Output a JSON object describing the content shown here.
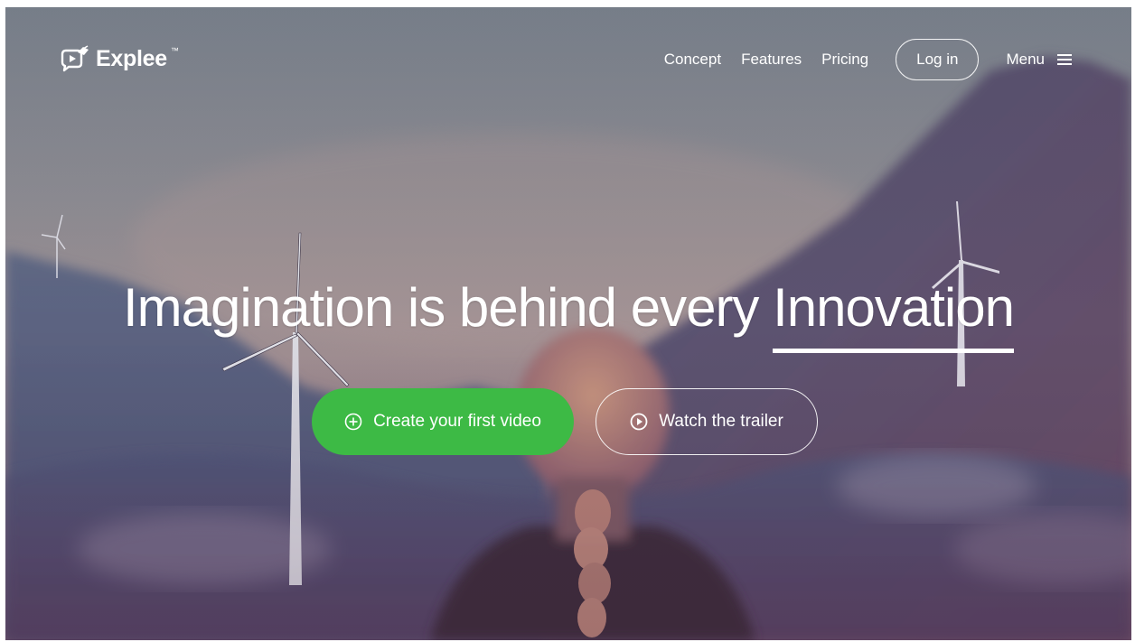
{
  "brand": {
    "name": "Explee",
    "trademark": "™",
    "logo_icon": "play-bubble-logo-icon"
  },
  "nav": {
    "links": [
      "Concept",
      "Features",
      "Pricing"
    ],
    "login_label": "Log in",
    "menu_label": "Menu",
    "menu_icon": "hamburger-icon"
  },
  "hero": {
    "title_prefix": "Imagination is behind every",
    "title_highlight": "Innovation",
    "primary_cta": {
      "label": "Create your first video",
      "icon": "plus-circle-icon",
      "color": "#3dba45"
    },
    "secondary_cta": {
      "label": "Watch the trailer",
      "icon": "play-circle-icon"
    }
  },
  "background": {
    "subject": "woman with braid facing mountains and wind turbines",
    "colors": [
      "#7e8791",
      "#6d6e88",
      "#6a4c63"
    ]
  }
}
